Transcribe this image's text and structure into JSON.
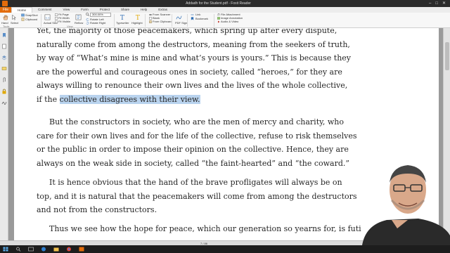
{
  "window": {
    "title": "Addadh for the Student.pdf - Foxit Reader"
  },
  "tabs": [
    "File",
    "Home",
    "Comment",
    "View",
    "Form",
    "Protect",
    "Share",
    "Help",
    "Extras"
  ],
  "ribbon": {
    "hand": "Hand",
    "select": "Select",
    "snapshot": "SnapShot",
    "clipboard": "Clipboard",
    "actual_size": "Actual Size",
    "fit_page": "Fit Page",
    "fit_width": "Fit Width",
    "fit_visible": "Fit Visible",
    "reflow": "Reflow",
    "zoom_value": "300.00%",
    "rotate_left": "Rotate Left",
    "rotate_right": "Rotate Right",
    "typewriter": "Typewriter",
    "highlight": "Highlight",
    "from_scanner": "From Scanner",
    "blank": "Blank",
    "from_clipboard": "From Clipboard",
    "pdf_sign": "PDF Sign",
    "link": "Link",
    "bookmark": "Bookmark",
    "file_attachment": "File Attachment",
    "image_annotation": "Image Annotation",
    "audio_video": "Audio & Video",
    "group_tools": "Tools",
    "group_view": "View"
  },
  "document": {
    "p1_l1": "Yet, the majority of those peacemakers, which spring up after every dispute,",
    "p1_l2": "naturally come from among the destructors, meaning from the seekers of truth,",
    "p1_l3": "by way of “What’s mine is mine and what’s yours is yours.” This is because they",
    "p1_l4": "are the powerful and courageous ones in society, called “heroes,” for they are",
    "p1_l5": "always willing to renounce their own lives and the lives of the whole collective,",
    "p1_l6_pre": "if the ",
    "p1_l6_hl": "collective disagrees with their view.",
    "p2_l1": "But the constructors in society, who are the men of mercy and charity, who",
    "p2_l2": "care for their own lives and for the life of the collective, refuse to risk themselves",
    "p2_l3": "or the public in order to impose their opinion on the collective. Hence, they are",
    "p2_l4": "always on the weak side in society, called “the faint-hearted” and “the coward.”",
    "p3_l1": "It is hence obvious that the hand of the brave profligates will always be on",
    "p3_l2": "top, and it is natural that the peacemakers will come from among the destructors",
    "p3_l3": "and not from the constructors.",
    "p4_l1": "Thus we see how the hope for peace, which our generation so yearns for, is futi"
  },
  "status": {
    "page": "7 / 86"
  },
  "colors": {
    "highlight": "#b9d3ee",
    "file_tab": "#e46c0a",
    "text": "#262626"
  }
}
